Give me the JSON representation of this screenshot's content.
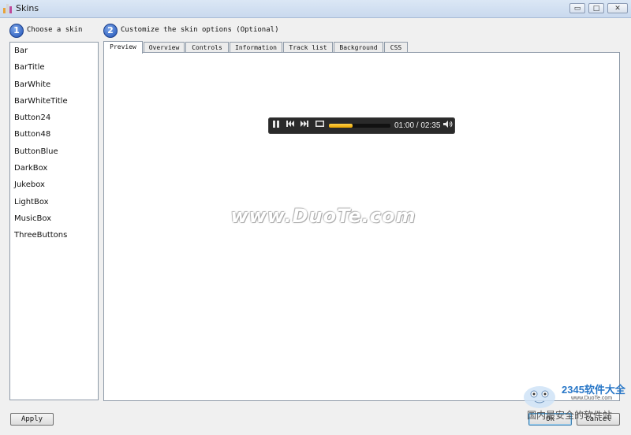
{
  "window": {
    "title": "Skins",
    "controls": {
      "minimize": "▭",
      "maximize": "□",
      "close": "✕"
    }
  },
  "steps": [
    {
      "number": "1",
      "label": "Choose a skin"
    },
    {
      "number": "2",
      "label": "Customize the skin options (Optional)"
    }
  ],
  "skins": [
    "Bar",
    "BarTitle",
    "BarWhite",
    "BarWhiteTitle",
    "Button24",
    "Button48",
    "ButtonBlue",
    "DarkBox",
    "Jukebox",
    "LightBox",
    "MusicBox",
    "ThreeButtons"
  ],
  "tabs": [
    "Preview",
    "Overview",
    "Controls",
    "Information",
    "Track list",
    "Background",
    "CSS"
  ],
  "active_tab": "Preview",
  "player": {
    "play_state": "paused",
    "icons": {
      "pause": "pause-icon",
      "previous": "previous-icon",
      "next": "next-icon",
      "repeat": "repeat-icon",
      "volume": "volume-icon"
    },
    "progress_fraction": 0.39,
    "time_text": "01:00 / 02:35",
    "accent": "#f2b800"
  },
  "watermark": "www.DuoTe.com",
  "buttons": {
    "apply": "Apply",
    "ok": "Ok",
    "cancel": "Cancel"
  },
  "corner_logo": {
    "brand": "2345软件大全",
    "site": "www.DuoTe.com",
    "caption": "国内最安全的软件站"
  }
}
